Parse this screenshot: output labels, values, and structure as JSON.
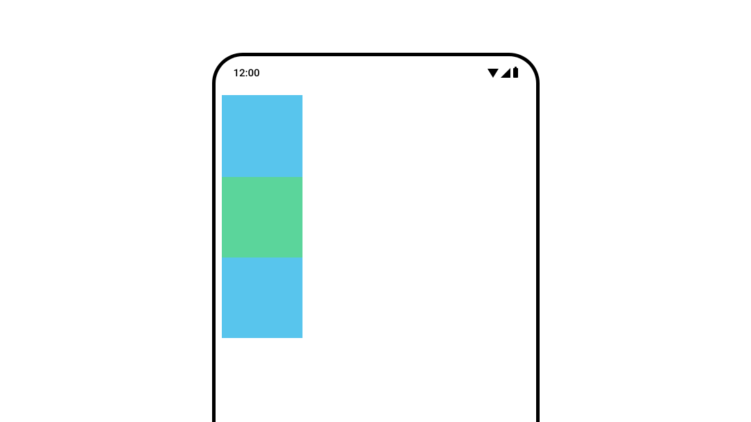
{
  "statusBar": {
    "time": "12:00"
  },
  "blocks": {
    "top": {
      "colorName": "light-blue"
    },
    "middle": {
      "colorName": "light-green"
    },
    "bottom": {
      "colorName": "light-blue"
    }
  }
}
